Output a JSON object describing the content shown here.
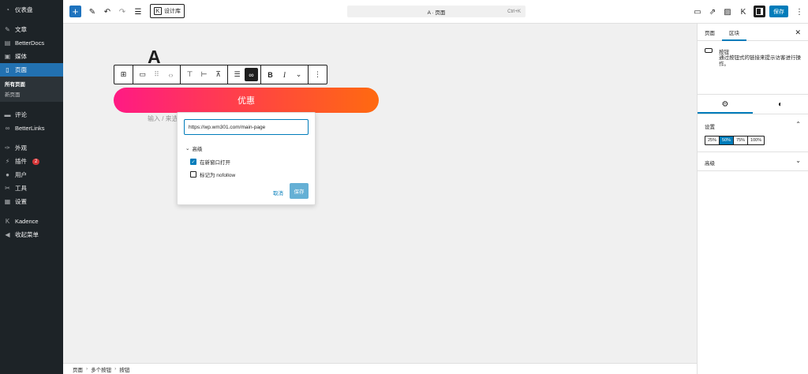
{
  "sidebar": {
    "items": [
      {
        "label": "仪表盘",
        "icon": "dashboard-icon",
        "glyph": "◔"
      },
      {
        "label": "文章",
        "icon": "pin-icon",
        "glyph": "✎"
      },
      {
        "label": "BetterDocs",
        "icon": "docs-icon",
        "glyph": "▤"
      },
      {
        "label": "媒体",
        "icon": "media-icon",
        "glyph": "▣"
      },
      {
        "label": "页面",
        "icon": "pages-icon",
        "glyph": "▯"
      }
    ],
    "sub": [
      "所有页面",
      "新页面"
    ],
    "items2": [
      {
        "label": "评论",
        "icon": "comments-icon",
        "glyph": "▬"
      },
      {
        "label": "BetterLinks",
        "icon": "link-icon",
        "glyph": "∞"
      },
      {
        "label": "外观",
        "icon": "appearance-icon",
        "glyph": "✑"
      },
      {
        "label": "插件",
        "icon": "plugins-icon",
        "glyph": "⚡",
        "badge": "2"
      },
      {
        "label": "用户",
        "icon": "users-icon",
        "glyph": "●"
      },
      {
        "label": "工具",
        "icon": "tools-icon",
        "glyph": "✂"
      },
      {
        "label": "设置",
        "icon": "settings-icon",
        "glyph": "▦"
      },
      {
        "label": "Kadence",
        "icon": "kadence-icon",
        "glyph": "K"
      },
      {
        "label": "收起菜单",
        "icon": "collapse-icon",
        "glyph": "◀"
      }
    ]
  },
  "topbar": {
    "design_library": "设计库",
    "command_title": "A · 页面",
    "command_shortcut": "Ctrl+K",
    "save": "保存"
  },
  "editor": {
    "heading": "A",
    "button_text": "优惠",
    "hint": "输入 / 来选"
  },
  "link_popover": {
    "url": "https://wp.wm301.com/main-page",
    "advanced": "高级",
    "open_new_tab": "在新窗口打开",
    "open_new_tab_checked": true,
    "nofollow": "标记为 nofollow",
    "nofollow_checked": false,
    "cancel": "取消",
    "save": "保存"
  },
  "settings": {
    "tabs": [
      "页面",
      "区块"
    ],
    "active_tab": "区块",
    "block_name": "按钮",
    "block_desc": "通过按钮式的链接来提示访客进行操作。",
    "section_settings": "设置",
    "widths": [
      "25%",
      "50%",
      "75%",
      "100%"
    ],
    "active_width": "50%",
    "section_advanced": "高级"
  },
  "breadcrumb": [
    "页面",
    "多个按钮",
    "按钮"
  ],
  "colors": {
    "accent": "#007cba",
    "wp_admin_bg": "#1d2327",
    "wp_active": "#2271b1",
    "gradient_start": "#ff1a84",
    "gradient_end": "#ff6a10"
  }
}
